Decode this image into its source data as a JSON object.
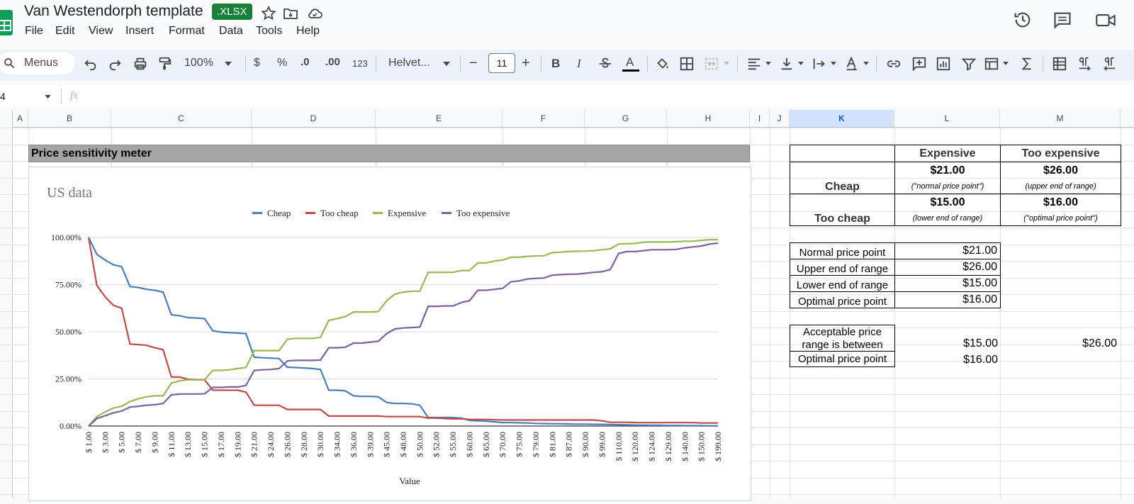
{
  "header": {
    "title": "Van Westendorph template",
    "badge": ".XLSX",
    "menu": [
      "File",
      "Edit",
      "View",
      "Insert",
      "Format",
      "Data",
      "Tools",
      "Help"
    ]
  },
  "toolbar": {
    "search_label": "Menus",
    "zoom": "100%",
    "currency": "$",
    "percent": "%",
    "dec_decrease": ".0",
    "dec_increase": ".00",
    "number_format": "123",
    "font": "Helvet...",
    "font_size": "11",
    "bold": "B",
    "italic": "I",
    "text_color": "A",
    "minus": "−",
    "plus": "+"
  },
  "formula_bar": {
    "cell_ref": "4",
    "fx": "fx"
  },
  "columns": [
    "A",
    "B",
    "C",
    "D",
    "E",
    "F",
    "G",
    "H",
    "I",
    "J",
    "K",
    "L",
    "M"
  ],
  "banner": "Price sensitivity meter",
  "matrix": {
    "col1": "Expensive",
    "col2": "Too expensive",
    "row1": "Cheap",
    "row2": "Too cheap",
    "r1c1_value": "$21.00",
    "r1c1_note": "(\"normal price point\")",
    "r1c2_value": "$26.00",
    "r1c2_note": "(upper end of range)",
    "r2c1_value": "$15.00",
    "r2c1_note": "(lower end of range)",
    "r2c2_value": "$16.00",
    "r2c2_note": "(\"optimal price point\")"
  },
  "summary": [
    {
      "label": "Normal price point",
      "value": "$21.00"
    },
    {
      "label": "Upper end of range",
      "value": "$26.00"
    },
    {
      "label": "Lower end of range",
      "value": "$15.00"
    },
    {
      "label": "Optimal price point",
      "value": "$16.00"
    }
  ],
  "range": {
    "label1": "Acceptable price",
    "label2": "range is between",
    "low": "$15.00",
    "high": "$26.00",
    "opt_label": "Optimal price point",
    "opt_value": "$16.00"
  },
  "chart_data": {
    "type": "line",
    "title": "US data",
    "xlabel": "Value",
    "ylabel": "",
    "ylim": [
      0,
      1
    ],
    "yticks": [
      "0.00%",
      "25.00%",
      "50.00%",
      "75.00%",
      "100.00%"
    ],
    "legend_position": "top",
    "xtick_labels": [
      "$ 1.00",
      "$ 3.00",
      "$ 5.00",
      "$ 7.00",
      "$ 9.00",
      "$ 11.00",
      "$ 13.00",
      "$ 15.00",
      "$ 17.00",
      "$ 19.00",
      "$ 21.00",
      "$ 24.00",
      "$ 26.00",
      "$ 28.00",
      "$ 30.00",
      "$ 34.00",
      "$ 36.00",
      "$ 39.00",
      "$ 45.00",
      "$ 48.00",
      "$ 50.00",
      "$ 52.00",
      "$ 55.00",
      "$ 60.00",
      "$ 65.00",
      "$ 70.00",
      "$ 75.00",
      "$ 79.00",
      "$ 81.00",
      "$ 87.00",
      "$ 90.00",
      "$ 99.00",
      "$ 110.00",
      "$ 120.00",
      "$ 124.00",
      "$ 129.00",
      "$ 140.00",
      "$ 150.00",
      "$ 199.00"
    ],
    "n_points": 77,
    "series": [
      {
        "name": "Cheap",
        "color": "#4a7ebb",
        "values": [
          1.0,
          0.91,
          0.88,
          0.855,
          0.845,
          0.74,
          0.735,
          0.725,
          0.72,
          0.71,
          0.59,
          0.585,
          0.575,
          0.573,
          0.57,
          0.505,
          0.498,
          0.495,
          0.493,
          0.49,
          0.365,
          0.362,
          0.36,
          0.358,
          0.312,
          0.31,
          0.308,
          0.305,
          0.3,
          0.19,
          0.19,
          0.187,
          0.16,
          0.157,
          0.157,
          0.155,
          0.125,
          0.12,
          0.12,
          0.118,
          0.11,
          0.045,
          0.045,
          0.045,
          0.045,
          0.042,
          0.03,
          0.028,
          0.026,
          0.022,
          0.018,
          0.018,
          0.017,
          0.016,
          0.014,
          0.013,
          0.012,
          0.012,
          0.011,
          0.01,
          0.01,
          0.009,
          0.009,
          0.008,
          0.007,
          0.006,
          0.005,
          0.005,
          0.004,
          0.004,
          0.003,
          0.003,
          0.002,
          0.002,
          0.002,
          0.001,
          0.001
        ]
      },
      {
        "name": "Too cheap",
        "color": "#be4b48",
        "values": [
          1.0,
          0.745,
          0.685,
          0.64,
          0.625,
          0.435,
          0.432,
          0.428,
          0.415,
          0.405,
          0.26,
          0.26,
          0.248,
          0.246,
          0.245,
          0.19,
          0.19,
          0.19,
          0.19,
          0.18,
          0.11,
          0.11,
          0.11,
          0.11,
          0.088,
          0.088,
          0.088,
          0.088,
          0.088,
          0.053,
          0.053,
          0.053,
          0.053,
          0.053,
          0.053,
          0.053,
          0.05,
          0.05,
          0.05,
          0.05,
          0.05,
          0.042,
          0.042,
          0.04,
          0.038,
          0.038,
          0.035,
          0.035,
          0.035,
          0.033,
          0.032,
          0.032,
          0.032,
          0.032,
          0.032,
          0.032,
          0.032,
          0.032,
          0.032,
          0.032,
          0.032,
          0.032,
          0.028,
          0.02,
          0.02,
          0.02,
          0.018,
          0.018,
          0.018,
          0.018,
          0.018,
          0.018,
          0.018,
          0.018,
          0.016,
          0.016,
          0.016
        ]
      },
      {
        "name": "Expensive",
        "color": "#98b954",
        "values": [
          0.0,
          0.05,
          0.075,
          0.095,
          0.105,
          0.13,
          0.145,
          0.155,
          0.16,
          0.16,
          0.228,
          0.24,
          0.245,
          0.245,
          0.246,
          0.295,
          0.295,
          0.298,
          0.305,
          0.31,
          0.4,
          0.4,
          0.4,
          0.4,
          0.46,
          0.465,
          0.465,
          0.465,
          0.47,
          0.56,
          0.57,
          0.58,
          0.605,
          0.605,
          0.605,
          0.607,
          0.665,
          0.7,
          0.71,
          0.715,
          0.715,
          0.815,
          0.815,
          0.815,
          0.815,
          0.825,
          0.825,
          0.865,
          0.865,
          0.875,
          0.88,
          0.895,
          0.895,
          0.9,
          0.902,
          0.903,
          0.92,
          0.922,
          0.925,
          0.927,
          0.928,
          0.93,
          0.935,
          0.94,
          0.965,
          0.967,
          0.968,
          0.975,
          0.976,
          0.976,
          0.976,
          0.978,
          0.98,
          0.98,
          0.985,
          0.988,
          0.988
        ]
      },
      {
        "name": "Too expensive",
        "color": "#7d60a0",
        "values": [
          0.0,
          0.04,
          0.055,
          0.07,
          0.08,
          0.1,
          0.105,
          0.11,
          0.113,
          0.12,
          0.165,
          0.17,
          0.17,
          0.17,
          0.171,
          0.205,
          0.205,
          0.207,
          0.207,
          0.215,
          0.295,
          0.298,
          0.3,
          0.305,
          0.345,
          0.348,
          0.348,
          0.348,
          0.35,
          0.415,
          0.415,
          0.418,
          0.44,
          0.44,
          0.445,
          0.45,
          0.49,
          0.515,
          0.52,
          0.522,
          0.525,
          0.635,
          0.635,
          0.637,
          0.637,
          0.655,
          0.665,
          0.72,
          0.72,
          0.725,
          0.73,
          0.765,
          0.77,
          0.78,
          0.783,
          0.785,
          0.8,
          0.803,
          0.805,
          0.806,
          0.81,
          0.815,
          0.818,
          0.83,
          0.915,
          0.925,
          0.925,
          0.93,
          0.935,
          0.935,
          0.935,
          0.937,
          0.945,
          0.95,
          0.955,
          0.965,
          0.97
        ]
      }
    ]
  }
}
